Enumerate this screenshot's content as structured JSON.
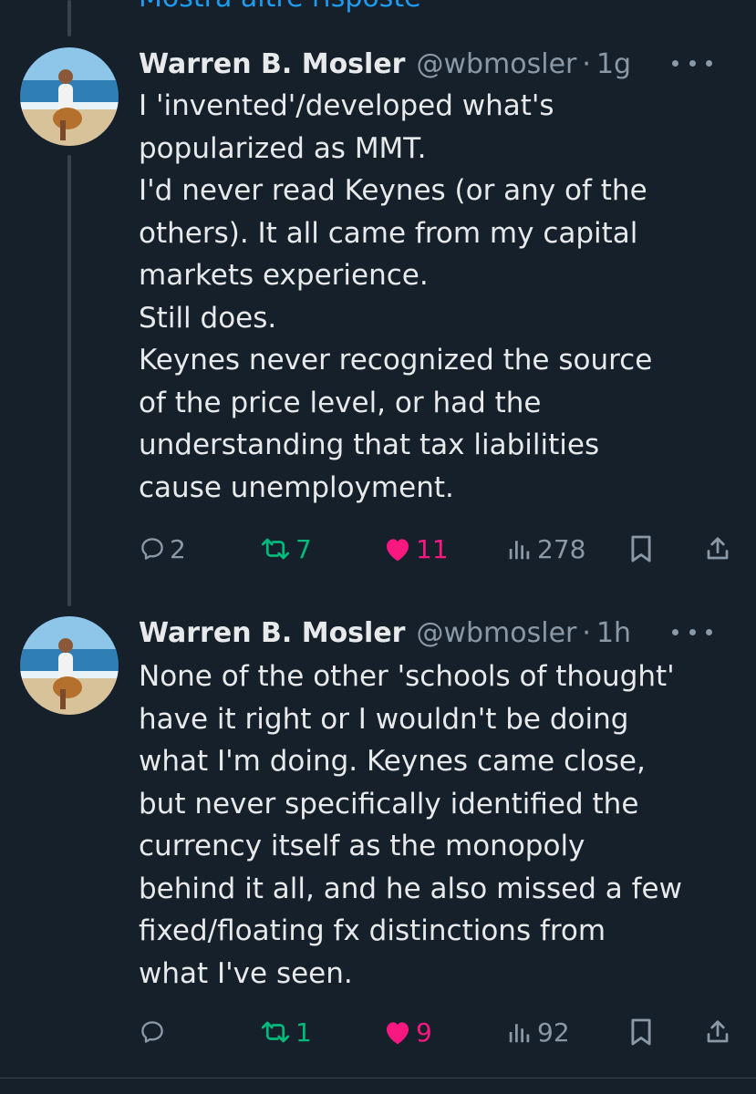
{
  "thread": {
    "show_more_replies": "Mostra altre risposte"
  },
  "tweets": [
    {
      "author_name": "Warren B. Mosler",
      "handle": "@wbmosler",
      "separator": "·",
      "time": "1g",
      "text_lines": [
        "I 'invented'/developed what's",
        "popularized as MMT.",
        "I'd never read Keynes (or any of the",
        "others). It all came from my capital",
        "markets experience.",
        "Still does.",
        "Keynes never recognized the source",
        "of the price level, or had the",
        "understanding that tax liabilities",
        "cause unemployment."
      ],
      "replies": "2",
      "reposts": "7",
      "likes": "11",
      "views": "278",
      "reply_icon": "comment-icon",
      "repost_icon": "repost-icon",
      "like_icon": "heart-filled-icon",
      "views_icon": "bar-chart-icon",
      "bookmark_icon": "bookmark-icon",
      "share_icon": "share-icon"
    },
    {
      "author_name": "Warren B. Mosler",
      "handle": "@wbmosler",
      "separator": "·",
      "time": "1h",
      "text_lines": [
        "None of the other 'schools of thought'",
        "have it right or I wouldn't be doing",
        "what I'm doing. Keynes came close,",
        "but never specifically identified the",
        "currency itself as the monopoly",
        "behind it all, and he also missed a few",
        "fixed/floating fx distinctions from",
        "what I've seen."
      ],
      "replies": "",
      "reposts": "1",
      "likes": "9",
      "views": "92",
      "reply_icon": "comment-icon",
      "repost_icon": "repost-icon",
      "like_icon": "heart-filled-icon",
      "views_icon": "bar-chart-icon",
      "bookmark_icon": "bookmark-icon",
      "share_icon": "share-icon"
    }
  ],
  "colors": {
    "background": "#15202b",
    "text": "#e7e9ea",
    "muted": "#8b98a5",
    "repost_active": "#00ba7c",
    "like_active": "#f91880",
    "link": "#1d9bf0"
  }
}
